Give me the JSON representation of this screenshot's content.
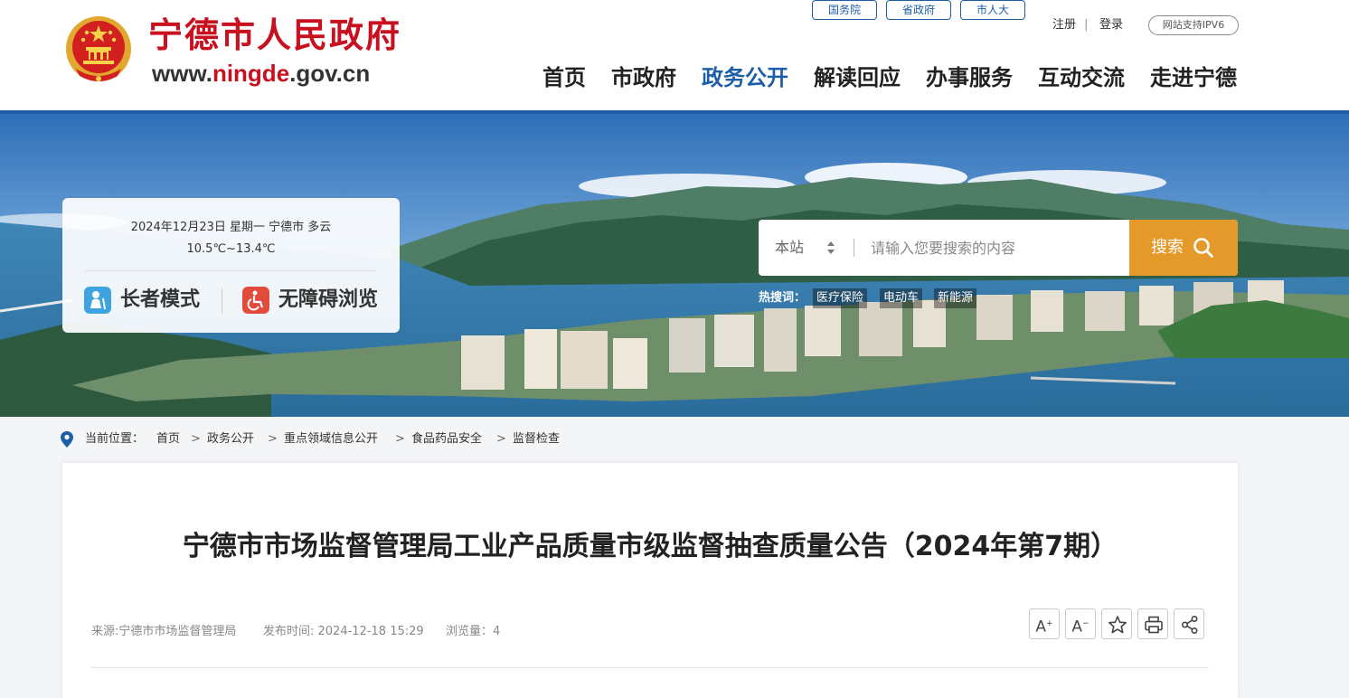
{
  "header": {
    "site_title": "宁德市人民政府",
    "url_prefix": "www.",
    "url_highlight": "ningde",
    "url_suffix": ".gov.cn",
    "top_links": [
      "国务院",
      "省政府",
      "市人大"
    ],
    "register": "注册",
    "login": "登录",
    "ipv6": "网站支持IPV6",
    "nav": [
      "首页",
      "市政府",
      "政务公开",
      "解读回应",
      "办事服务",
      "互动交流",
      "走进宁德"
    ],
    "active_nav": "政务公开"
  },
  "banner": {
    "weather_line1": "2024年12月23日 星期一   宁德市 多云",
    "weather_line2": "10.5℃~13.4℃",
    "elder_mode": "长者模式",
    "accessible_mode": "无障碍浏览",
    "search": {
      "scope": "本站",
      "placeholder": "请输入您要搜索的内容",
      "button": "搜索"
    },
    "hot_label": "热搜词：",
    "hot_words": [
      "医疗保险",
      "电动车",
      "新能源"
    ]
  },
  "breadcrumb": {
    "label": "当前位置：",
    "items": [
      "首页",
      "政务公开",
      "重点领域信息公开",
      "食品药品安全",
      "监督检查"
    ],
    "separator": ">"
  },
  "article": {
    "title": "宁德市市场监督管理局工业产品质量市级监督抽查质量公告（2024年第7期）",
    "source": "来源:宁德市市场监督管理局",
    "publish_time": "发布时间: 2024-12-18 15:29",
    "views": "浏览量：4",
    "tools": {
      "font_increase": "A",
      "font_increase_sup": "+",
      "font_decrease": "A",
      "font_decrease_sup": "−"
    }
  },
  "colors": {
    "brand_red": "#c8101e",
    "nav_blue": "#1d5ea8",
    "search_orange": "#e49a2a"
  }
}
